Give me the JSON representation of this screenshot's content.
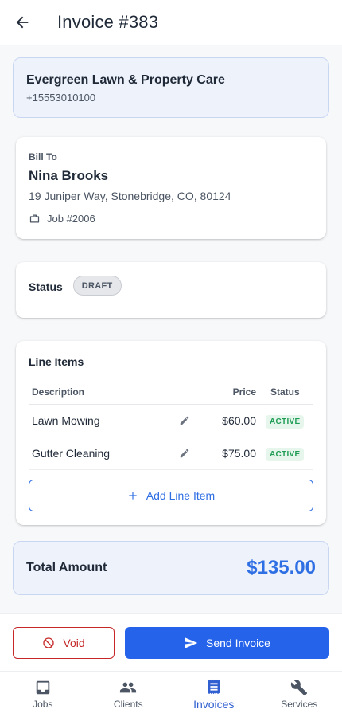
{
  "appbar": {
    "title": "Invoice #383"
  },
  "company": {
    "name": "Evergreen Lawn & Property Care",
    "phone": "+15553010100"
  },
  "bill_to": {
    "label": "Bill To",
    "name": "Nina Brooks",
    "address": "19 Juniper Way, Stonebridge, CO, 80124",
    "job": "Job #2006"
  },
  "status": {
    "label": "Status",
    "value": "DRAFT"
  },
  "line_items": {
    "title": "Line Items",
    "headers": {
      "description": "Description",
      "price": "Price",
      "status": "Status"
    },
    "rows": [
      {
        "description": "Lawn Mowing",
        "price": "$60.00",
        "status": "ACTIVE"
      },
      {
        "description": "Gutter Cleaning",
        "price": "$75.00",
        "status": "ACTIVE"
      }
    ],
    "add_label": "Add Line Item"
  },
  "total": {
    "label": "Total Amount",
    "value": "$135.00"
  },
  "actions": {
    "void_label": "Void",
    "send_label": "Send Invoice"
  },
  "nav": [
    {
      "label": "Jobs",
      "icon": "inbox-icon"
    },
    {
      "label": "Clients",
      "icon": "people-icon"
    },
    {
      "label": "Invoices",
      "icon": "receipt-icon",
      "active": true
    },
    {
      "label": "Services",
      "icon": "wrench-icon"
    }
  ],
  "colors": {
    "accent": "#2f6fe4",
    "danger": "#c62828",
    "success": "#1f9d55",
    "highlight_bg": "#eef2fb"
  }
}
